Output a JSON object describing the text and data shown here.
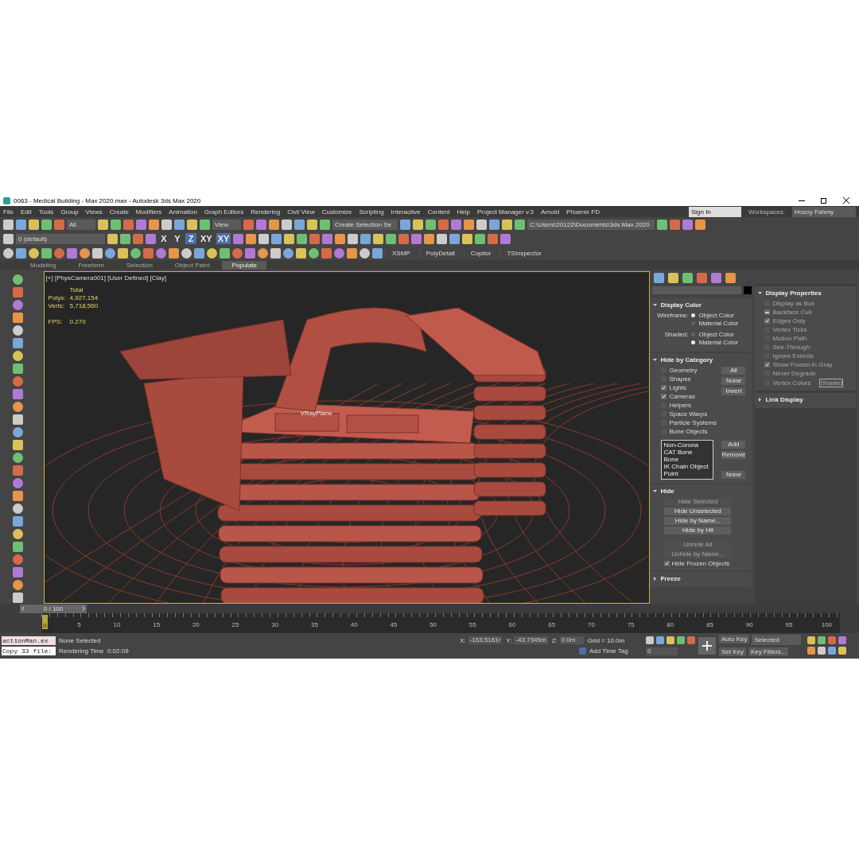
{
  "window": {
    "title": "0063 - Medical Building - Max 2020.max - Autodesk 3ds Max 2020"
  },
  "menu": [
    "File",
    "Edit",
    "Tools",
    "Group",
    "Views",
    "Create",
    "Modifiers",
    "Animation",
    "Graph Editors",
    "Rendering",
    "Civil View",
    "Customize",
    "Scripting",
    "Interactive",
    "Content",
    "Help",
    "Project Manager v.3",
    "Arnold",
    "Phoenix FD"
  ],
  "account": {
    "sign_in": "Sign In",
    "workspaces_label": "Workspaces:",
    "workspace": "Hosny Fahmy"
  },
  "toolbar": {
    "selection_filter": "All",
    "reference_coord": "View",
    "named_selection": "Create Selection Se",
    "layer": "0 (default)",
    "project_path": "C:\\Users\\20122\\Documents\\3ds Max 2020",
    "axes": [
      {
        "label": "X",
        "selected": false
      },
      {
        "label": "Y",
        "selected": false
      },
      {
        "label": "Z",
        "selected": true
      },
      {
        "label": "XY",
        "selected": false
      },
      {
        "label": "XY",
        "selected": true
      }
    ],
    "plugins": [
      "XSMP",
      "PolyDetail",
      "Copitor",
      "TSInspector"
    ]
  },
  "ribbon_tabs": [
    {
      "label": "Modeling",
      "selected": false
    },
    {
      "label": "Freeform",
      "selected": false
    },
    {
      "label": "Selection",
      "selected": false
    },
    {
      "label": "Object Paint",
      "selected": false
    },
    {
      "label": "Populate",
      "selected": true
    }
  ],
  "viewport": {
    "label": "[+] [PhysCamera001] [User Defined] [Clay]",
    "stats_title": "Total",
    "stats": [
      {
        "label": "Polys:",
        "value": "4,927,154"
      },
      {
        "label": "Verts:",
        "value": "5,718,560"
      }
    ],
    "fps": {
      "label": "FPS:",
      "value": "0.270"
    },
    "object_label": "VRayPlane"
  },
  "command_panel": {
    "display_color": {
      "title": "Display Color",
      "expanded": true,
      "groups": [
        {
          "label": "Wireframe:",
          "options": [
            {
              "label": "Object Color",
              "selected": true
            },
            {
              "label": "Material Color",
              "selected": false
            }
          ]
        },
        {
          "label": "Shaded:",
          "options": [
            {
              "label": "Object Color",
              "selected": false
            },
            {
              "label": "Material Color",
              "selected": true
            }
          ]
        }
      ]
    },
    "hide_by_category": {
      "title": "Hide by Category",
      "expanded": true,
      "items": [
        {
          "label": "Geometry",
          "checked": false
        },
        {
          "label": "Shapes",
          "checked": false
        },
        {
          "label": "Lights",
          "checked": true
        },
        {
          "label": "Cameras",
          "checked": true
        },
        {
          "label": "Helpers",
          "checked": false
        },
        {
          "label": "Space Warps",
          "checked": false
        },
        {
          "label": "Particle Systems",
          "checked": false
        },
        {
          "label": "Bone Objects",
          "checked": false
        }
      ],
      "buttons": [
        "All",
        "None",
        "Invert"
      ],
      "list": [
        "Non-Corona",
        "CAT Bone",
        "Bone",
        "IK Chain Object",
        "Point"
      ],
      "list_buttons": [
        "Add",
        "Remove",
        "None"
      ]
    },
    "hide": {
      "title": "Hide",
      "expanded": true,
      "buttons": [
        {
          "label": "Hide Selected",
          "disabled": true
        },
        {
          "label": "Hide Unselected",
          "disabled": false
        },
        {
          "label": "Hide by Name...",
          "disabled": false
        },
        {
          "label": "Hide by Hit",
          "disabled": false
        },
        {
          "label": "Unhide All",
          "disabled": true
        },
        {
          "label": "Unhide by Name...",
          "disabled": true
        }
      ],
      "checkbox": {
        "label": "Hide Frozen Objects",
        "checked": true
      }
    },
    "freeze": {
      "title": "Freeze",
      "expanded": false
    },
    "display_properties": {
      "title": "Display Properties",
      "expanded": true,
      "items": [
        {
          "label": "Display as Box",
          "checked": false,
          "indeterminate": false
        },
        {
          "label": "Backface Cull",
          "checked": true,
          "indeterminate": true
        },
        {
          "label": "Edges Only",
          "checked": true,
          "indeterminate": false
        },
        {
          "label": "Vertex Ticks",
          "checked": false,
          "indeterminate": false
        },
        {
          "label": "Motion Path",
          "checked": false,
          "indeterminate": false
        },
        {
          "label": "See-Through",
          "checked": false,
          "indeterminate": false
        },
        {
          "label": "Ignore Extents",
          "checked": false,
          "indeterminate": false
        },
        {
          "label": "Show Frozen in Gray",
          "checked": true,
          "indeterminate": false
        },
        {
          "label": "Never Degrade",
          "checked": false,
          "indeterminate": false
        },
        {
          "label": "Vertex Colors",
          "checked": false,
          "indeterminate": false
        }
      ],
      "shaded_button": "Shaded"
    },
    "link_display": {
      "title": "Link Display",
      "expanded": false
    }
  },
  "timeline": {
    "frame": "0 / 100",
    "level": 0,
    "thumb": "0",
    "ticks": [
      "5",
      "10",
      "15",
      "20",
      "25",
      "30",
      "35",
      "40",
      "45",
      "50",
      "55",
      "60",
      "65",
      "70",
      "75",
      "80",
      "85",
      "90",
      "95",
      "100"
    ]
  },
  "status": {
    "script_lines": [
      "actionMan.ex",
      "Copy 33 file:"
    ],
    "selection": "None Selected",
    "render_time": "Rendering Time  0:02:09",
    "coords": [
      {
        "label": "X:",
        "value": "-163.5161r"
      },
      {
        "label": "Y:",
        "value": "-43.7345m"
      },
      {
        "label": "Z:",
        "value": "0.0m"
      }
    ],
    "grid": "Grid = 10.0m",
    "time_tag": "Add Time Tag",
    "frame_field": "0",
    "auto_key": "Auto Key",
    "set_key": "Set Key",
    "key_mode": "Selected",
    "key_filters": "Key Filters..."
  }
}
